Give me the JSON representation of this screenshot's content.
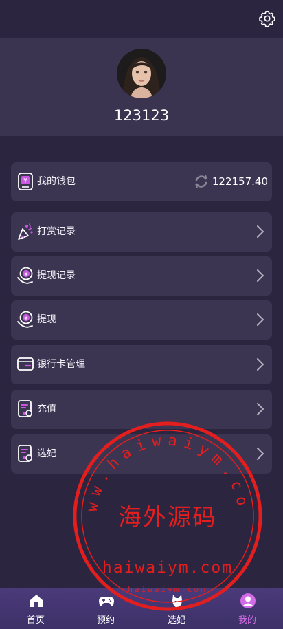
{
  "profile": {
    "username": "123123",
    "avatar_alt": "avatar"
  },
  "wallet": {
    "label": "我的钱包",
    "amount": "122157.40"
  },
  "menu": [
    {
      "label": "打赏记录",
      "icon": "gift-icon"
    },
    {
      "label": "提现记录",
      "icon": "yuan-coin-icon"
    },
    {
      "label": "提现",
      "icon": "yuan-coin-icon"
    },
    {
      "label": "银行卡管理",
      "icon": "bank-card-icon"
    },
    {
      "label": "充值",
      "icon": "recharge-document-icon"
    },
    {
      "label": "选妃",
      "icon": "select-document-icon"
    }
  ],
  "tabs": [
    {
      "label": "首页",
      "icon": "home-icon"
    },
    {
      "label": "预约",
      "icon": "gamepad-icon"
    },
    {
      "label": "选妃",
      "icon": "fox-icon"
    },
    {
      "label": "我的",
      "icon": "user-icon"
    }
  ],
  "watermark": {
    "url_top": "www.haiwaiym.com",
    "name": "海外源码",
    "url_mid": "haiwaiym.com",
    "url_small": "haiwaiym.com"
  },
  "colors": {
    "accent": "#d36be6",
    "background": "#2b2540",
    "card": "#3c3552",
    "stamp_red": "#e31e1e"
  }
}
